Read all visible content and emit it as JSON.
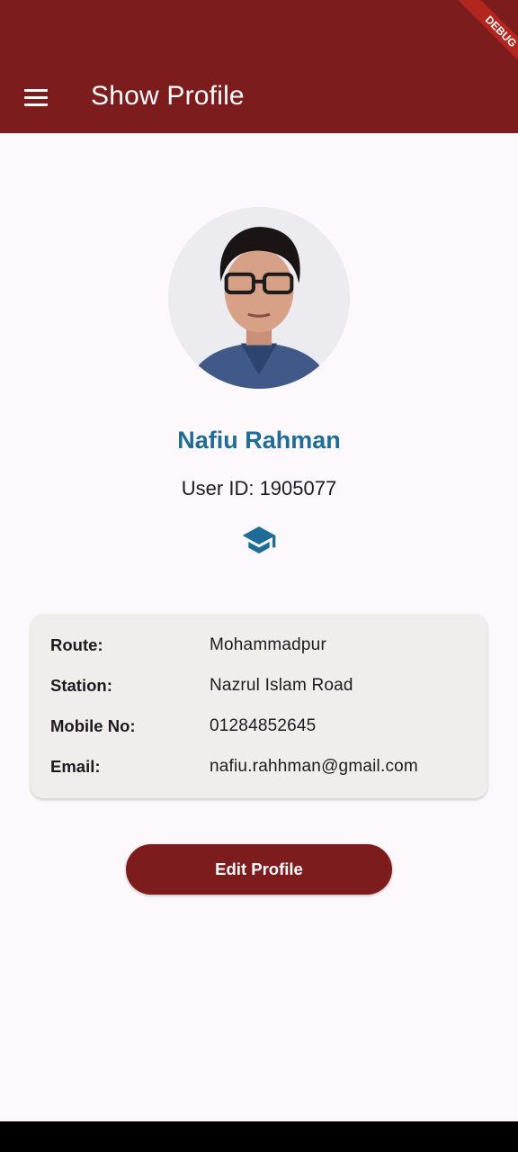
{
  "app_bar": {
    "title": "Show Profile",
    "menu_icon": "menu-icon",
    "color": "#7d1c1d"
  },
  "debug_banner": {
    "label": "DEBUG"
  },
  "profile": {
    "name": "Nafiu Rahman",
    "user_id": "User ID: 1905077",
    "role_icon": "school-icon",
    "name_color": "#1f6d96"
  },
  "details": [
    {
      "label": "Route:",
      "value": "Mohammadpur"
    },
    {
      "label": "Station:",
      "value": "Nazrul Islam Road"
    },
    {
      "label": "Mobile No:",
      "value": "01284852645"
    },
    {
      "label": "Email:",
      "value": "nafiu.rahhman@gmail.com"
    }
  ],
  "edit_button": {
    "label": "Edit Profile"
  }
}
